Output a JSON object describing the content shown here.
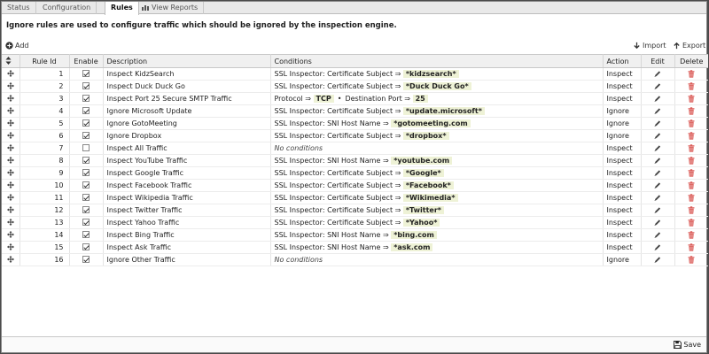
{
  "tabs": [
    {
      "label": "Status"
    },
    {
      "label": "Configuration"
    },
    {
      "label": "Rules"
    },
    {
      "label": "View Reports"
    }
  ],
  "info_text": "Ignore rules are used to configure traffic which should be ignored by the inspection engine.",
  "toolbar": {
    "add": "Add",
    "import": "Import",
    "export": "Export"
  },
  "columns": {
    "rule_id": "Rule Id",
    "enable": "Enable",
    "description": "Description",
    "conditions": "Conditions",
    "action": "Action",
    "edit": "Edit",
    "delete": "Delete"
  },
  "rules": [
    {
      "id": "1",
      "enabled": true,
      "description": "Inspect KidzSearch",
      "conditions": [
        {
          "label": "SSL Inspector: Certificate Subject ⇒",
          "value": "*kidzsearch*"
        }
      ],
      "action": "Inspect"
    },
    {
      "id": "2",
      "enabled": true,
      "description": "Inspect Duck Duck Go",
      "conditions": [
        {
          "label": "SSL Inspector: Certificate Subject ⇒",
          "value": "*Duck Duck Go*"
        }
      ],
      "action": "Inspect"
    },
    {
      "id": "3",
      "enabled": true,
      "description": "Inspect Port 25 Secure SMTP Traffic",
      "conditions": [
        {
          "label": "Protocol ⇒",
          "value": "TCP"
        },
        {
          "label": "Destination Port ⇒",
          "value": "25"
        }
      ],
      "action": "Inspect"
    },
    {
      "id": "4",
      "enabled": true,
      "description": "Ignore Microsoft Update",
      "conditions": [
        {
          "label": "SSL Inspector: Certificate Subject ⇒",
          "value": "*update.microsoft*"
        }
      ],
      "action": "Ignore"
    },
    {
      "id": "5",
      "enabled": true,
      "description": "Ignore GotoMeeting",
      "conditions": [
        {
          "label": "SSL Inspector: SNI Host Name ⇒",
          "value": "*gotomeeting.com"
        }
      ],
      "action": "Ignore"
    },
    {
      "id": "6",
      "enabled": true,
      "description": "Ignore Dropbox",
      "conditions": [
        {
          "label": "SSL Inspector: Certificate Subject ⇒",
          "value": "*dropbox*"
        }
      ],
      "action": "Ignore"
    },
    {
      "id": "7",
      "enabled": false,
      "description": "Inspect All Traffic",
      "conditions": [],
      "no_conditions": "No conditions",
      "action": "Inspect"
    },
    {
      "id": "8",
      "enabled": true,
      "description": "Inspect YouTube Traffic",
      "conditions": [
        {
          "label": "SSL Inspector: SNI Host Name ⇒",
          "value": "*youtube.com"
        }
      ],
      "action": "Inspect"
    },
    {
      "id": "9",
      "enabled": true,
      "description": "Inspect Google Traffic",
      "conditions": [
        {
          "label": "SSL Inspector: Certificate Subject ⇒",
          "value": "*Google*"
        }
      ],
      "action": "Inspect"
    },
    {
      "id": "10",
      "enabled": true,
      "description": "Inspect Facebook Traffic",
      "conditions": [
        {
          "label": "SSL Inspector: Certificate Subject ⇒",
          "value": "*Facebook*"
        }
      ],
      "action": "Inspect"
    },
    {
      "id": "11",
      "enabled": true,
      "description": "Inspect Wikipedia Traffic",
      "conditions": [
        {
          "label": "SSL Inspector: Certificate Subject ⇒",
          "value": "*Wikimedia*"
        }
      ],
      "action": "Inspect"
    },
    {
      "id": "12",
      "enabled": true,
      "description": "Inspect Twitter Traffic",
      "conditions": [
        {
          "label": "SSL Inspector: Certificate Subject ⇒",
          "value": "*Twitter*"
        }
      ],
      "action": "Inspect"
    },
    {
      "id": "13",
      "enabled": true,
      "description": "Inspect Yahoo Traffic",
      "conditions": [
        {
          "label": "SSL Inspector: Certificate Subject ⇒",
          "value": "*Yahoo*"
        }
      ],
      "action": "Inspect"
    },
    {
      "id": "14",
      "enabled": true,
      "description": "Inspect Bing Traffic",
      "conditions": [
        {
          "label": "SSL Inspector: SNI Host Name ⇒",
          "value": "*bing.com"
        }
      ],
      "action": "Inspect"
    },
    {
      "id": "15",
      "enabled": true,
      "description": "Inspect Ask Traffic",
      "conditions": [
        {
          "label": "SSL Inspector: SNI Host Name ⇒",
          "value": "*ask.com"
        }
      ],
      "action": "Inspect"
    },
    {
      "id": "16",
      "enabled": true,
      "description": "Ignore Other Traffic",
      "conditions": [],
      "no_conditions": "No conditions",
      "action": "Ignore"
    }
  ],
  "footer": {
    "save": "Save"
  },
  "colors": {
    "delete_icon": "#d9534f",
    "highlight": "#eef2d6"
  }
}
